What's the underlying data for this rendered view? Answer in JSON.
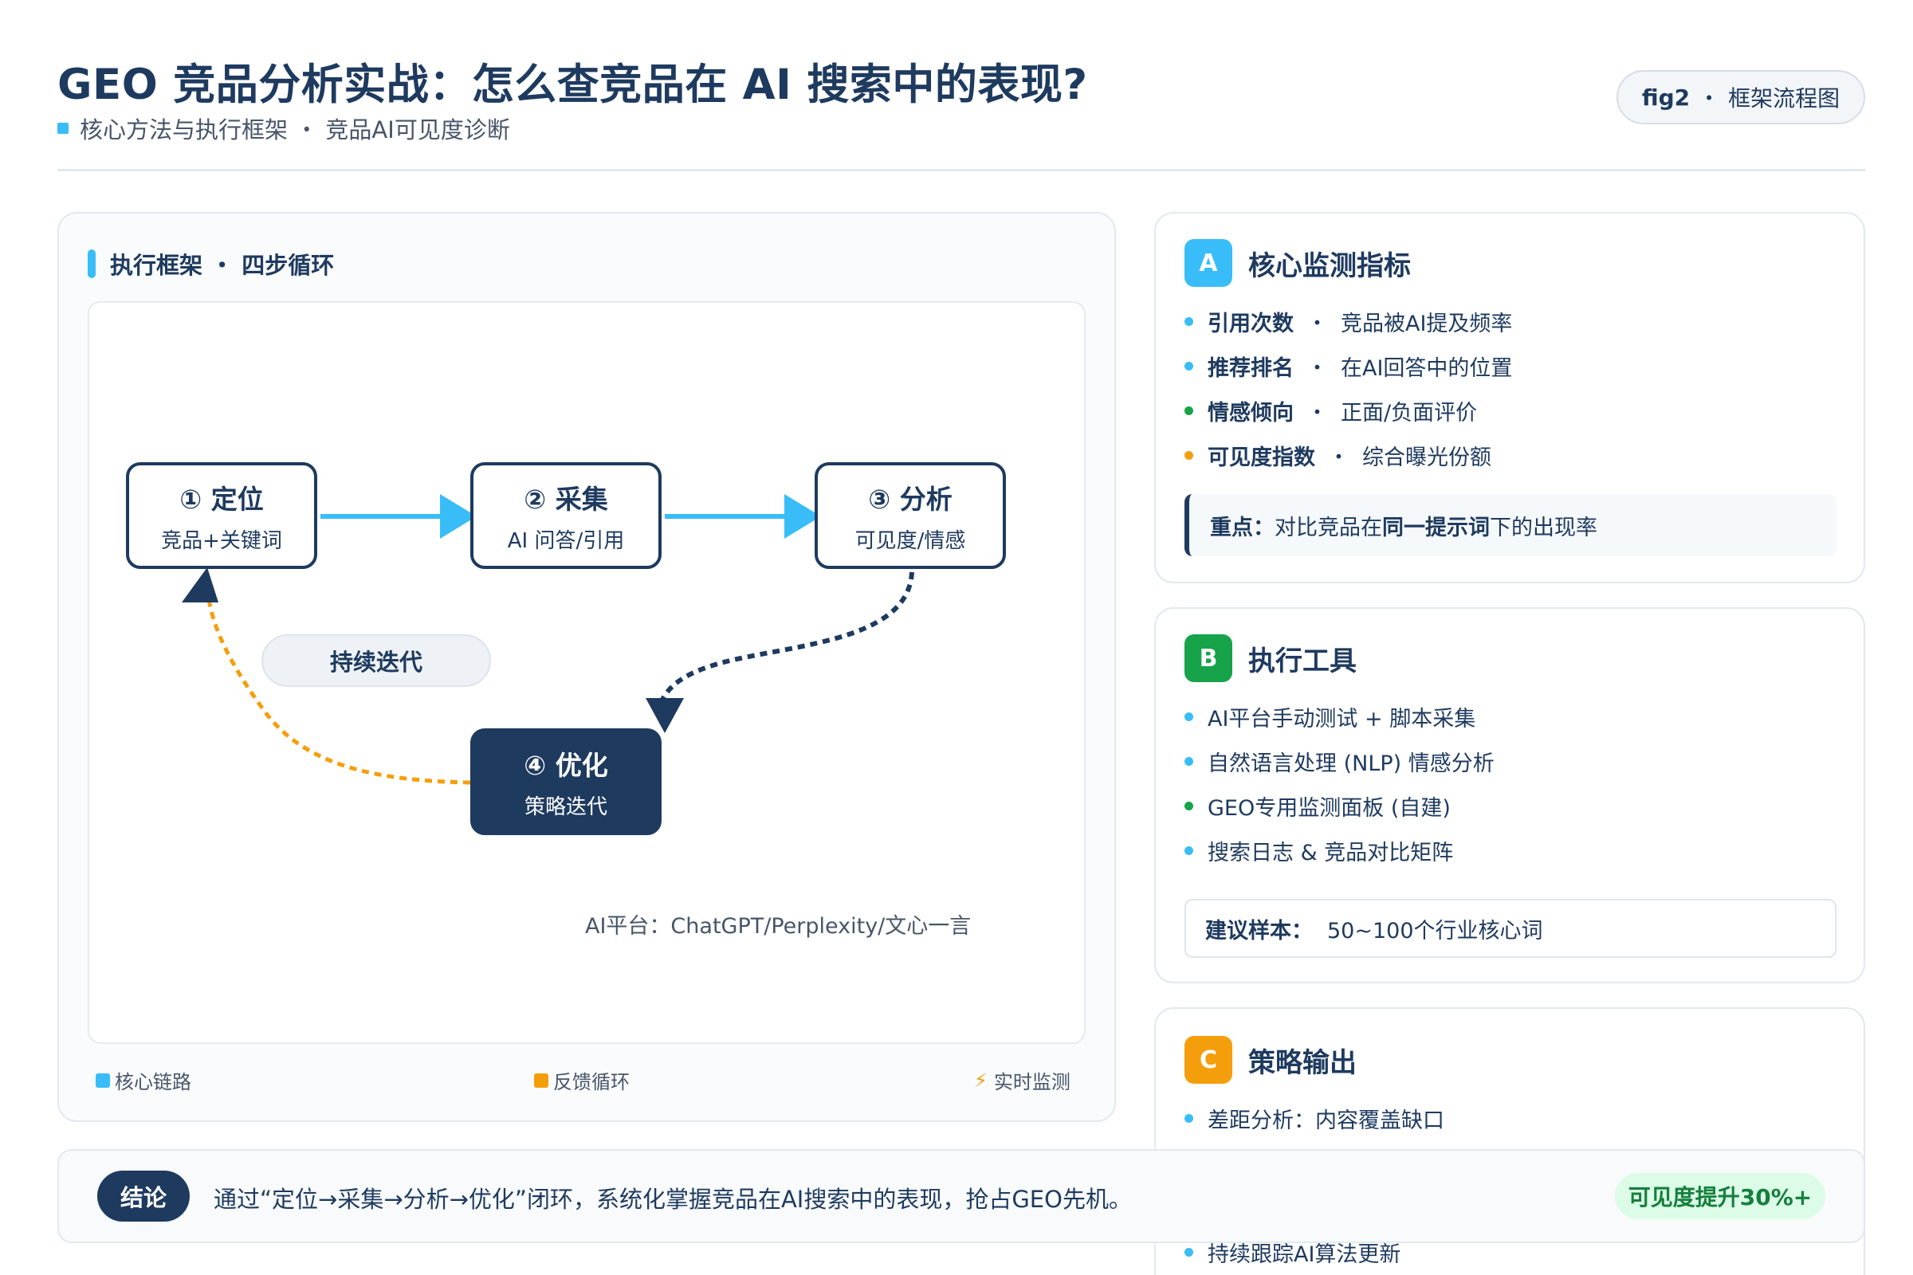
{
  "header": {
    "title": "GEO 竞品分析实战：怎么查竞品在 AI 搜索中的表现?",
    "subtitle": "核心方法与执行框架 ・ 竞品AI可见度诊断",
    "fig_id": "fig2",
    "fig_sep": "・",
    "fig_label": "框架流程图"
  },
  "framework": {
    "header": "执行框架 ・ 四步循环",
    "steps": [
      {
        "title": "① 定位",
        "sub": "竞品+关键词"
      },
      {
        "title": "② 采集",
        "sub": "AI 问答/引用"
      },
      {
        "title": "③ 分析",
        "sub": "可见度/情感"
      },
      {
        "title": "④ 优化",
        "sub": "策略迭代"
      }
    ],
    "iterate_label": "持续迭代",
    "platform_note": "AI平台：ChatGPT/Perplexity/文心一言",
    "legend": {
      "core": "核心链路",
      "feedback": "反馈循环",
      "live": "实时监测",
      "live_icon": "⚡"
    },
    "colors": {
      "core": "#38bdf8",
      "feedback": "#f59e0b",
      "navy": "#1e3a5f"
    }
  },
  "card_a": {
    "letter": "A",
    "title": "核心监测指标",
    "color": "#38bdf8",
    "items": [
      {
        "key": "引用次数",
        "sep": "・",
        "desc": "竞品被AI提及频率",
        "dot": "#38bdf8"
      },
      {
        "key": "推荐排名",
        "sep": "・",
        "desc": "在AI回答中的位置",
        "dot": "#38bdf8"
      },
      {
        "key": "情感倾向",
        "sep": "・",
        "desc": "正面/负面评价",
        "dot": "#16a34a"
      },
      {
        "key": "可见度指数",
        "sep": "・",
        "desc": "综合曝光份额",
        "dot": "#f59e0b"
      }
    ],
    "note_bold1": "重点：",
    "note_text1": "对比竞品在",
    "note_bold2": "同一提示词",
    "note_text2": "下的出现率"
  },
  "card_b": {
    "letter": "B",
    "title": "执行工具",
    "color": "#16a34a",
    "items": [
      {
        "text": "AI平台手动测试 + 脚本采集",
        "dot": "#38bdf8"
      },
      {
        "text": "自然语言处理 (NLP) 情感分析",
        "dot": "#38bdf8"
      },
      {
        "text": "GEO专用监测面板 (自建)",
        "dot": "#16a34a"
      },
      {
        "text": "搜索日志 & 竞品对比矩阵",
        "dot": "#38bdf8"
      }
    ],
    "note_label": "建议样本：",
    "note_value": "50~100个行业核心词"
  },
  "card_c": {
    "letter": "C",
    "title": "策略输出",
    "color": "#f59e0b",
    "items": [
      {
        "text": "差距分析：内容覆盖缺口",
        "dot": "#38bdf8"
      },
      {
        "text": "持续跟踪AI算法更新",
        "dot": "#38bdf8"
      }
    ]
  },
  "conclusion": {
    "tag": "结论",
    "text": "通过“定位→采集→分析→优化”闭环，系统化掌握竞品在AI搜索中的表现，抢占GEO先机。",
    "badge": "可见度提升30%+"
  }
}
